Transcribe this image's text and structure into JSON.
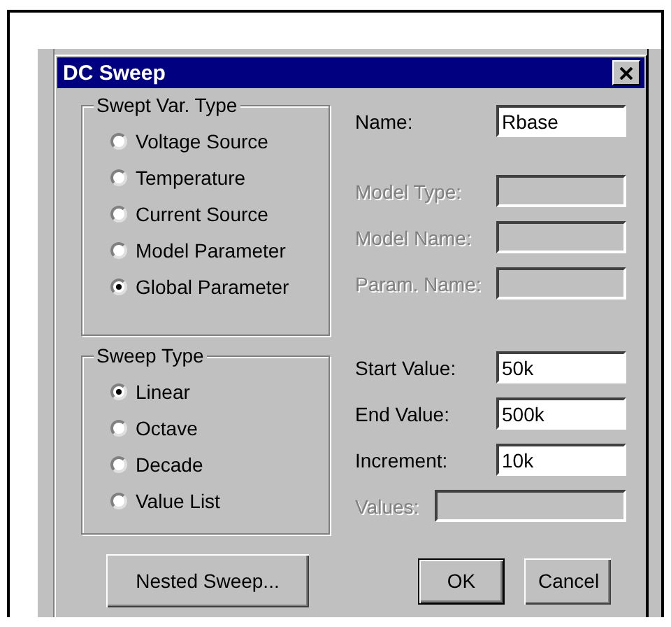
{
  "window": {
    "title": "DC Sweep"
  },
  "swept_var_type": {
    "title": "Swept Var. Type",
    "options": [
      {
        "label": "Voltage Source",
        "selected": false
      },
      {
        "label": "Temperature",
        "selected": false
      },
      {
        "label": "Current Source",
        "selected": false
      },
      {
        "label": "Model Parameter",
        "selected": false
      },
      {
        "label": "Global Parameter",
        "selected": true
      }
    ]
  },
  "sweep_type": {
    "title": "Sweep Type",
    "options": [
      {
        "label": "Linear",
        "selected": true
      },
      {
        "label": "Octave",
        "selected": false
      },
      {
        "label": "Decade",
        "selected": false
      },
      {
        "label": "Value List",
        "selected": false
      }
    ]
  },
  "parameter_fields": [
    {
      "label": "Name:",
      "value": "Rbase",
      "disabled": false
    },
    {
      "label": "Model Type:",
      "disabled": true
    },
    {
      "label": "Model Name:",
      "disabled": true
    },
    {
      "label": "Param. Name:",
      "disabled": true
    }
  ],
  "range_fields": [
    {
      "label": "Start Value:",
      "value": "50k",
      "disabled": false
    },
    {
      "label": "End Value:",
      "value": "500k",
      "disabled": false
    },
    {
      "label": "Increment:",
      "value": "10k",
      "disabled": false
    }
  ],
  "values_field": {
    "label": "Values:",
    "disabled": true
  },
  "buttons": [
    {
      "label": "Nested Sweep...",
      "kind": "secondary"
    },
    {
      "label": "OK",
      "kind": "default"
    },
    {
      "label": "Cancel",
      "kind": "normal"
    }
  ]
}
